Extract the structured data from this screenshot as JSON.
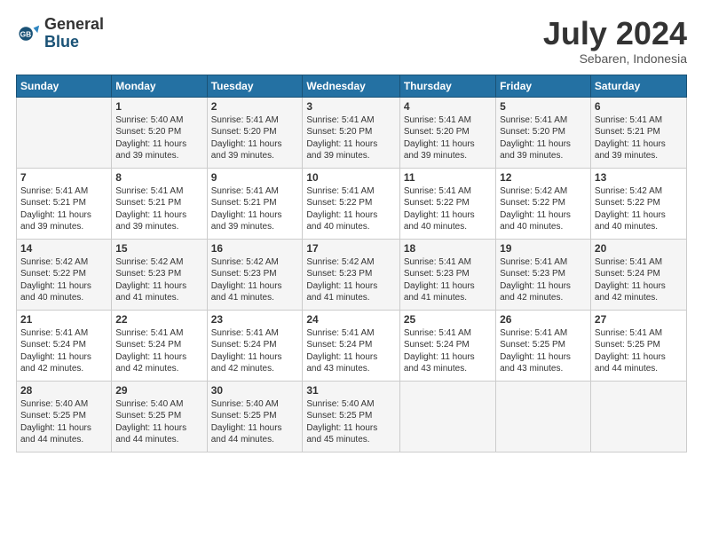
{
  "header": {
    "logo_general": "General",
    "logo_blue": "Blue",
    "month_title": "July 2024",
    "location": "Sebaren, Indonesia"
  },
  "weekdays": [
    "Sunday",
    "Monday",
    "Tuesday",
    "Wednesday",
    "Thursday",
    "Friday",
    "Saturday"
  ],
  "weeks": [
    [
      {
        "day": "",
        "info": ""
      },
      {
        "day": "1",
        "info": "Sunrise: 5:40 AM\nSunset: 5:20 PM\nDaylight: 11 hours\nand 39 minutes."
      },
      {
        "day": "2",
        "info": "Sunrise: 5:41 AM\nSunset: 5:20 PM\nDaylight: 11 hours\nand 39 minutes."
      },
      {
        "day": "3",
        "info": "Sunrise: 5:41 AM\nSunset: 5:20 PM\nDaylight: 11 hours\nand 39 minutes."
      },
      {
        "day": "4",
        "info": "Sunrise: 5:41 AM\nSunset: 5:20 PM\nDaylight: 11 hours\nand 39 minutes."
      },
      {
        "day": "5",
        "info": "Sunrise: 5:41 AM\nSunset: 5:20 PM\nDaylight: 11 hours\nand 39 minutes."
      },
      {
        "day": "6",
        "info": "Sunrise: 5:41 AM\nSunset: 5:21 PM\nDaylight: 11 hours\nand 39 minutes."
      }
    ],
    [
      {
        "day": "7",
        "info": "Sunrise: 5:41 AM\nSunset: 5:21 PM\nDaylight: 11 hours\nand 39 minutes."
      },
      {
        "day": "8",
        "info": "Sunrise: 5:41 AM\nSunset: 5:21 PM\nDaylight: 11 hours\nand 39 minutes."
      },
      {
        "day": "9",
        "info": "Sunrise: 5:41 AM\nSunset: 5:21 PM\nDaylight: 11 hours\nand 39 minutes."
      },
      {
        "day": "10",
        "info": "Sunrise: 5:41 AM\nSunset: 5:22 PM\nDaylight: 11 hours\nand 40 minutes."
      },
      {
        "day": "11",
        "info": "Sunrise: 5:41 AM\nSunset: 5:22 PM\nDaylight: 11 hours\nand 40 minutes."
      },
      {
        "day": "12",
        "info": "Sunrise: 5:42 AM\nSunset: 5:22 PM\nDaylight: 11 hours\nand 40 minutes."
      },
      {
        "day": "13",
        "info": "Sunrise: 5:42 AM\nSunset: 5:22 PM\nDaylight: 11 hours\nand 40 minutes."
      }
    ],
    [
      {
        "day": "14",
        "info": "Sunrise: 5:42 AM\nSunset: 5:22 PM\nDaylight: 11 hours\nand 40 minutes."
      },
      {
        "day": "15",
        "info": "Sunrise: 5:42 AM\nSunset: 5:23 PM\nDaylight: 11 hours\nand 41 minutes."
      },
      {
        "day": "16",
        "info": "Sunrise: 5:42 AM\nSunset: 5:23 PM\nDaylight: 11 hours\nand 41 minutes."
      },
      {
        "day": "17",
        "info": "Sunrise: 5:42 AM\nSunset: 5:23 PM\nDaylight: 11 hours\nand 41 minutes."
      },
      {
        "day": "18",
        "info": "Sunrise: 5:41 AM\nSunset: 5:23 PM\nDaylight: 11 hours\nand 41 minutes."
      },
      {
        "day": "19",
        "info": "Sunrise: 5:41 AM\nSunset: 5:23 PM\nDaylight: 11 hours\nand 42 minutes."
      },
      {
        "day": "20",
        "info": "Sunrise: 5:41 AM\nSunset: 5:24 PM\nDaylight: 11 hours\nand 42 minutes."
      }
    ],
    [
      {
        "day": "21",
        "info": "Sunrise: 5:41 AM\nSunset: 5:24 PM\nDaylight: 11 hours\nand 42 minutes."
      },
      {
        "day": "22",
        "info": "Sunrise: 5:41 AM\nSunset: 5:24 PM\nDaylight: 11 hours\nand 42 minutes."
      },
      {
        "day": "23",
        "info": "Sunrise: 5:41 AM\nSunset: 5:24 PM\nDaylight: 11 hours\nand 42 minutes."
      },
      {
        "day": "24",
        "info": "Sunrise: 5:41 AM\nSunset: 5:24 PM\nDaylight: 11 hours\nand 43 minutes."
      },
      {
        "day": "25",
        "info": "Sunrise: 5:41 AM\nSunset: 5:24 PM\nDaylight: 11 hours\nand 43 minutes."
      },
      {
        "day": "26",
        "info": "Sunrise: 5:41 AM\nSunset: 5:25 PM\nDaylight: 11 hours\nand 43 minutes."
      },
      {
        "day": "27",
        "info": "Sunrise: 5:41 AM\nSunset: 5:25 PM\nDaylight: 11 hours\nand 44 minutes."
      }
    ],
    [
      {
        "day": "28",
        "info": "Sunrise: 5:40 AM\nSunset: 5:25 PM\nDaylight: 11 hours\nand 44 minutes."
      },
      {
        "day": "29",
        "info": "Sunrise: 5:40 AM\nSunset: 5:25 PM\nDaylight: 11 hours\nand 44 minutes."
      },
      {
        "day": "30",
        "info": "Sunrise: 5:40 AM\nSunset: 5:25 PM\nDaylight: 11 hours\nand 44 minutes."
      },
      {
        "day": "31",
        "info": "Sunrise: 5:40 AM\nSunset: 5:25 PM\nDaylight: 11 hours\nand 45 minutes."
      },
      {
        "day": "",
        "info": ""
      },
      {
        "day": "",
        "info": ""
      },
      {
        "day": "",
        "info": ""
      }
    ]
  ]
}
